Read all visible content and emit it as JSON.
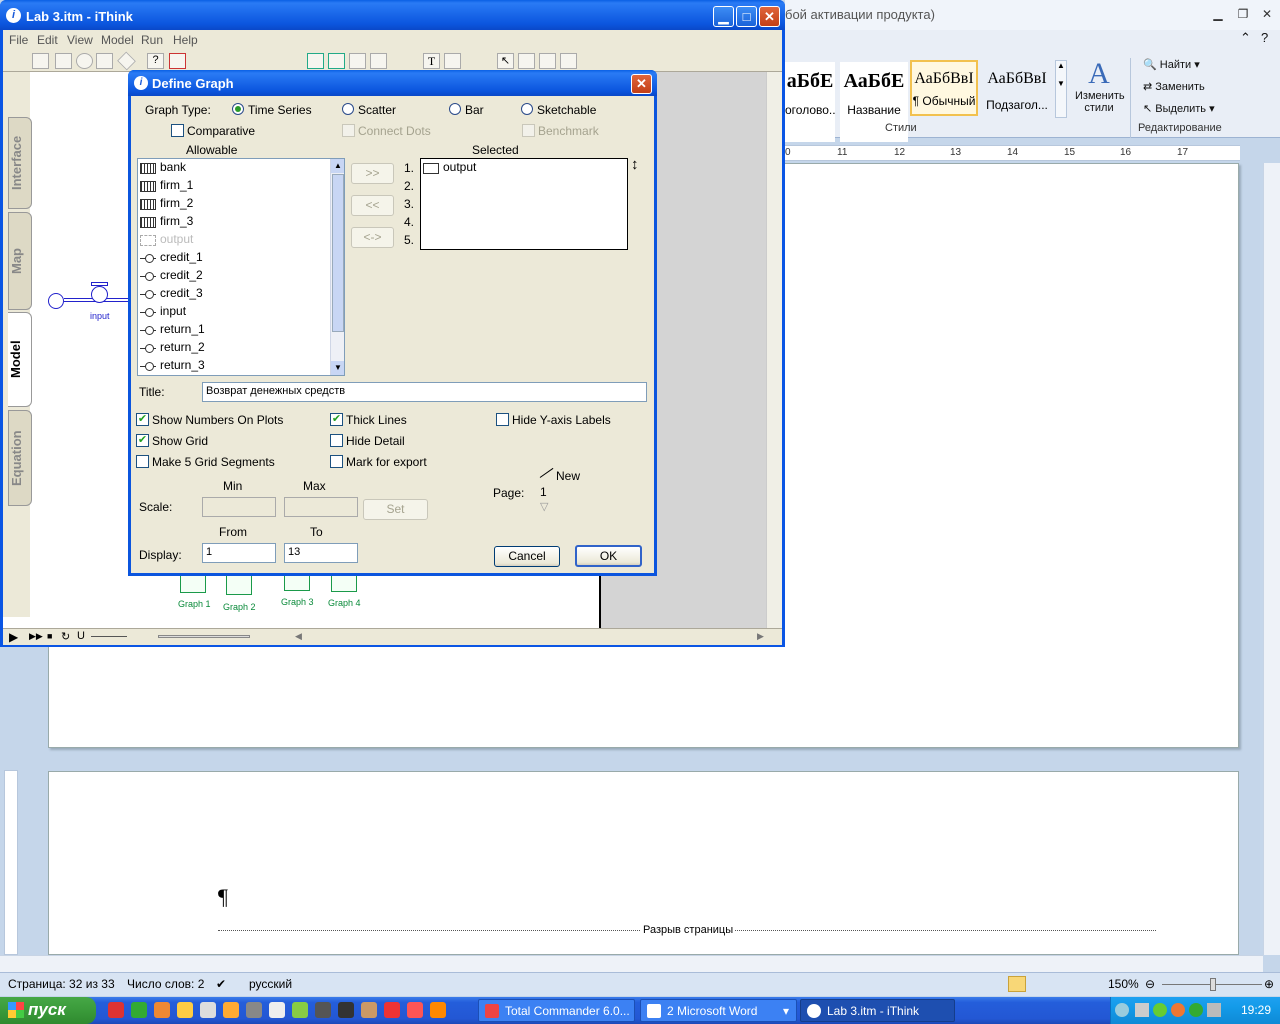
{
  "word": {
    "title_partial": "бой активации продукта)",
    "styles": [
      {
        "preview": "аБбЕ",
        "name": "оголово..."
      },
      {
        "preview": "АаБбЕ",
        "name": "Название"
      },
      {
        "preview": "АаБбВвI",
        "name": "¶ Обычный"
      },
      {
        "preview": "АаБбВвI",
        "name": "Подзагол..."
      }
    ],
    "change_styles": "Изменить стили",
    "styles_group": "Стили",
    "edit_group": "Редактирование",
    "find": "Найти",
    "replace": "Заменить",
    "select": "Выделить",
    "ruler_ticks": [
      "0",
      "11",
      "12",
      "13",
      "14",
      "15",
      "16",
      "17"
    ],
    "pilcrow": "¶",
    "page_break": "Разрыв страницы",
    "status": {
      "page": "Страница: 32 из 33",
      "words": "Число слов: 2",
      "lang": "русский",
      "zoom": "150%"
    }
  },
  "taskbar": {
    "start": "пуск",
    "tasks": [
      "Total Commander 6.0...",
      "2 Microsoft Word",
      "Lab 3.itm - iThink"
    ],
    "lang": "EN",
    "time": "19:29"
  },
  "ithink": {
    "title": "Lab 3.itm - iThink",
    "menu": [
      "File",
      "Edit",
      "View",
      "Model",
      "Run",
      "Help"
    ],
    "tabs": [
      "Interface",
      "Map",
      "Model",
      "Equation"
    ],
    "input_label": "input",
    "graphs": [
      "Graph 1",
      "Graph 2",
      "Graph 3",
      "Graph 4"
    ]
  },
  "dialog": {
    "title": "Define Graph",
    "graph_type_label": "Graph Type:",
    "graph_types": [
      "Time Series",
      "Scatter",
      "Bar",
      "Sketchable"
    ],
    "selected_type": "Time Series",
    "comparative": "Comparative",
    "connect_dots": "Connect Dots",
    "benchmark": "Benchmark",
    "allowable_label": "Allowable",
    "selected_label": "Selected",
    "allowable": [
      {
        "name": "bank",
        "kind": "stock"
      },
      {
        "name": "firm_1",
        "kind": "stock"
      },
      {
        "name": "firm_2",
        "kind": "stock"
      },
      {
        "name": "firm_3",
        "kind": "stock"
      },
      {
        "name": "output",
        "kind": "ghost"
      },
      {
        "name": "credit_1",
        "kind": "flow"
      },
      {
        "name": "credit_2",
        "kind": "flow"
      },
      {
        "name": "credit_3",
        "kind": "flow"
      },
      {
        "name": "input",
        "kind": "flow"
      },
      {
        "name": "return_1",
        "kind": "flow"
      },
      {
        "name": "return_2",
        "kind": "flow"
      },
      {
        "name": "return_3",
        "kind": "flow"
      }
    ],
    "move_buttons": [
      ">>",
      "<<",
      "<->"
    ],
    "slot_numbers": [
      "1.",
      "2.",
      "3.",
      "4.",
      "5."
    ],
    "selected": [
      "output"
    ],
    "title_label": "Title:",
    "title_value": "Возврат денежных средств",
    "options": {
      "show_numbers": {
        "label": "Show Numbers On Plots",
        "checked": true
      },
      "show_grid": {
        "label": "Show Grid",
        "checked": true
      },
      "five_grid": {
        "label": "Make 5 Grid Segments",
        "checked": false
      },
      "thick_lines": {
        "label": "Thick Lines",
        "checked": true
      },
      "hide_detail": {
        "label": "Hide Detail",
        "checked": false
      },
      "mark_export": {
        "label": "Mark for export",
        "checked": false
      },
      "hide_y": {
        "label": "Hide Y-axis Labels",
        "checked": false
      }
    },
    "min_label": "Min",
    "max_label": "Max",
    "scale_label": "Scale:",
    "set_button": "Set",
    "page_label": "Page:",
    "page_new": "New",
    "page_value": "1",
    "from_label": "From",
    "to_label": "To",
    "display_label": "Display:",
    "display_from": "1",
    "display_to": "13",
    "cancel": "Cancel",
    "ok": "OK"
  }
}
